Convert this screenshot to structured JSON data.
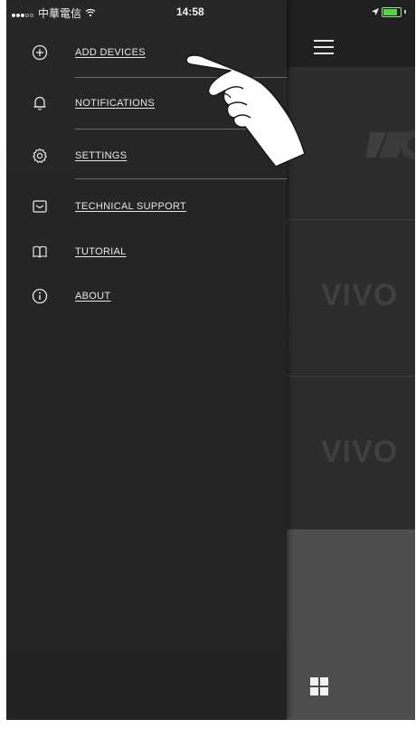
{
  "status_bar": {
    "carrier": "中華電信",
    "time": "14:58"
  },
  "menu": {
    "items": [
      {
        "label": "ADD DEVICES",
        "icon": "plus-circle-icon"
      },
      {
        "label": "NOTIFICATIONS",
        "icon": "bell-icon"
      },
      {
        "label": "SETTINGS",
        "icon": "gear-icon"
      },
      {
        "label": "TECHNICAL SUPPORT",
        "icon": "mail-icon"
      },
      {
        "label": "TUTORIAL",
        "icon": "book-icon"
      },
      {
        "label": "ABOUT",
        "icon": "info-icon"
      }
    ]
  },
  "app": {
    "brand_text": "VIVO"
  },
  "colors": {
    "drawer_bg": "#262626",
    "text": "#e6e6e6",
    "battery_green": "#57d04a"
  }
}
